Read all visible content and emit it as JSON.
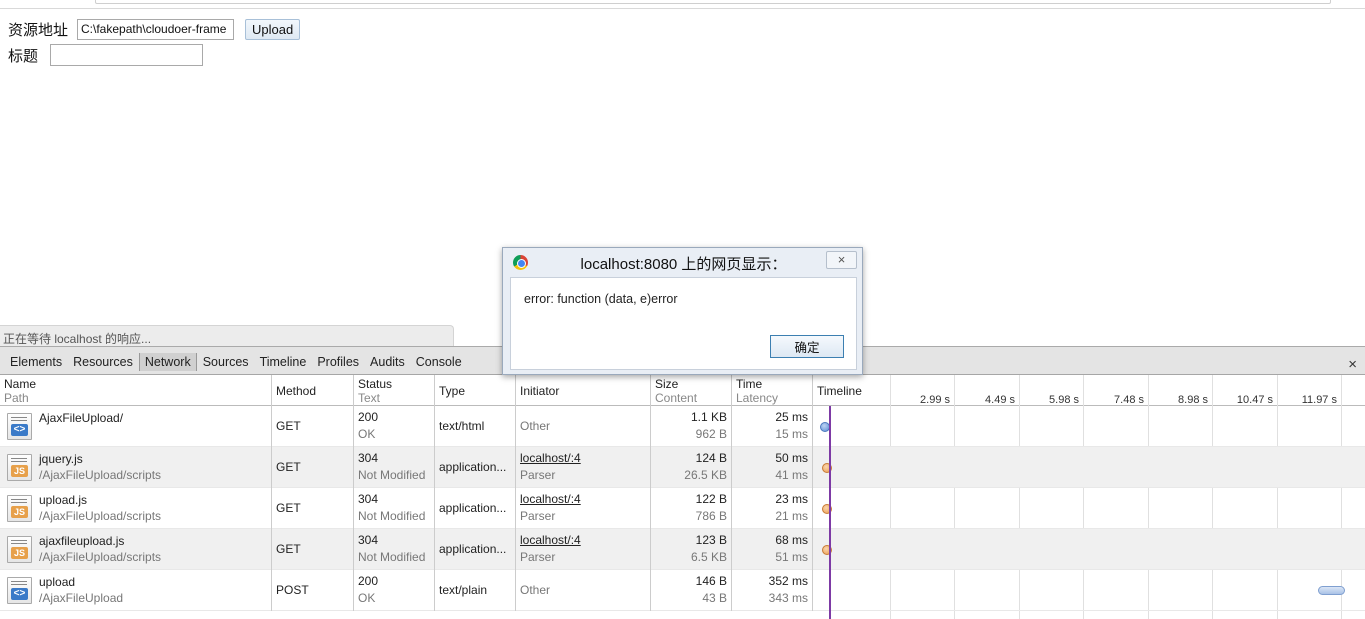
{
  "page": {
    "form": {
      "resource_label": "资源地址",
      "file_value": "C:\\fakepath\\cloudoer-frame",
      "upload_label": "Upload",
      "title_label": "标题",
      "title_value": ""
    },
    "status_text": "正在等待 localhost 的响应..."
  },
  "dialog": {
    "title": "localhost:8080 上的网页显示：",
    "message": "error: function (data, e)error",
    "ok_label": "确定",
    "close_glyph": "×"
  },
  "devtools": {
    "tabs": [
      "Elements",
      "Resources",
      "Network",
      "Sources",
      "Timeline",
      "Profiles",
      "Audits",
      "Console"
    ],
    "active_tab": "Network",
    "close_glyph": "×",
    "columns": {
      "name": "Name",
      "path": "Path",
      "method": "Method",
      "status": "Status",
      "text": "Text",
      "type": "Type",
      "initiator": "Initiator",
      "size": "Size",
      "content": "Content",
      "time": "Time",
      "latency": "Latency",
      "timeline": "Timeline"
    },
    "timeline_ticks": [
      "2.99 s",
      "4.49 s",
      "5.98 s",
      "7.48 s",
      "8.98 s",
      "10.47 s",
      "11.97 s"
    ],
    "requests": [
      {
        "name": "AjaxFileUpload/",
        "path": "",
        "icon": "html",
        "method": "GET",
        "status": "200",
        "status_text": "OK",
        "type": "text/html",
        "initiator": "Other",
        "initiator_sub": "",
        "size": "1.1 KB",
        "content": "962 B",
        "time": "25 ms",
        "latency": "15 ms"
      },
      {
        "name": "jquery.js",
        "path": "/AjaxFileUpload/scripts",
        "icon": "js",
        "method": "GET",
        "status": "304",
        "status_text": "Not Modified",
        "type": "application...",
        "initiator": "localhost/:4",
        "initiator_sub": "Parser",
        "size": "124 B",
        "content": "26.5 KB",
        "time": "50 ms",
        "latency": "41 ms"
      },
      {
        "name": "upload.js",
        "path": "/AjaxFileUpload/scripts",
        "icon": "js",
        "method": "GET",
        "status": "304",
        "status_text": "Not Modified",
        "type": "application...",
        "initiator": "localhost/:4",
        "initiator_sub": "Parser",
        "size": "122 B",
        "content": "786 B",
        "time": "23 ms",
        "latency": "21 ms"
      },
      {
        "name": "ajaxfileupload.js",
        "path": "/AjaxFileUpload/scripts",
        "icon": "js",
        "method": "GET",
        "status": "304",
        "status_text": "Not Modified",
        "type": "application...",
        "initiator": "localhost/:4",
        "initiator_sub": "Parser",
        "size": "123 B",
        "content": "6.5 KB",
        "time": "68 ms",
        "latency": "51 ms"
      },
      {
        "name": "upload",
        "path": "/AjaxFileUpload",
        "icon": "html",
        "method": "POST",
        "status": "200",
        "status_text": "OK",
        "type": "text/plain",
        "initiator": "Other",
        "initiator_sub": "",
        "size": "146 B",
        "content": "43 B",
        "time": "352 ms",
        "latency": "343 ms"
      }
    ]
  },
  "colors": {
    "timeline_marker": "#7d3aa5",
    "html_bar": "#5b8dd6",
    "js_bar": "#e99a4f"
  }
}
